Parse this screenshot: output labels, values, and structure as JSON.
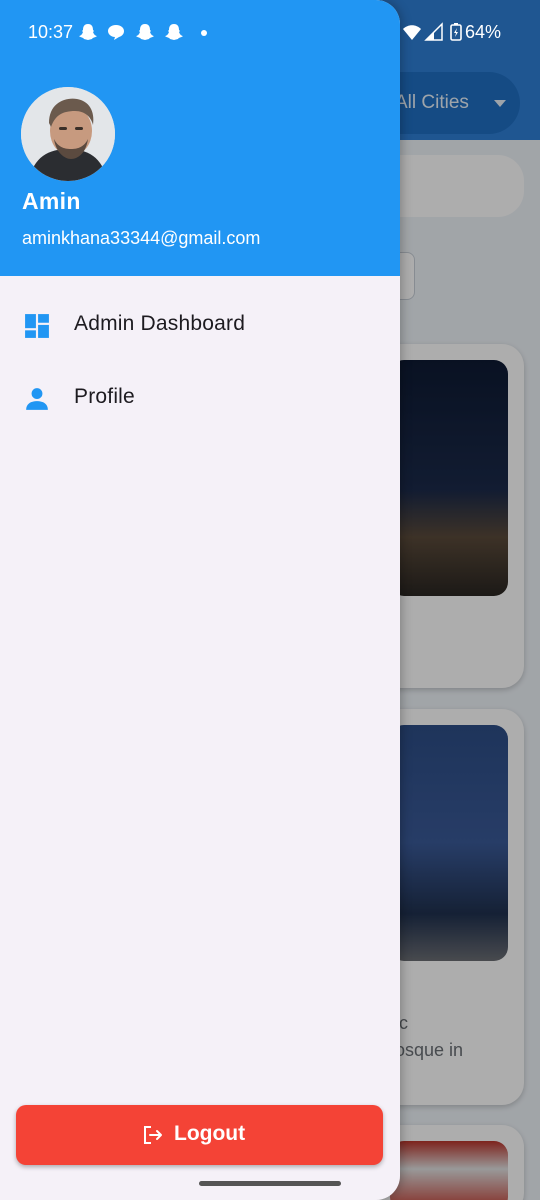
{
  "status_bar": {
    "time": "10:37",
    "battery": "64%",
    "notification_icons": [
      "snapchat-icon",
      "chat-bubble-icon",
      "snapchat-icon",
      "snapchat-icon",
      "dot-icon"
    ],
    "system_icons": [
      "wifi-icon",
      "signal-icon",
      "battery-icon"
    ]
  },
  "background": {
    "city_select": "All Cities",
    "card2_text_line1": "mic",
    "card2_text_line2": "mosque in"
  },
  "drawer": {
    "user_name": "Amin",
    "user_email": "aminkhana33344@gmail.com",
    "menu": [
      {
        "label": "Admin Dashboard",
        "icon": "dashboard-icon"
      },
      {
        "label": "Profile",
        "icon": "person-icon"
      }
    ],
    "logout_label": "Logout",
    "logout_icon": "logout-icon"
  },
  "colors": {
    "header": "#2196f3",
    "logout": "#f44336",
    "drawer_bg": "#f5f1f8",
    "icon_accent": "#2196f3"
  }
}
